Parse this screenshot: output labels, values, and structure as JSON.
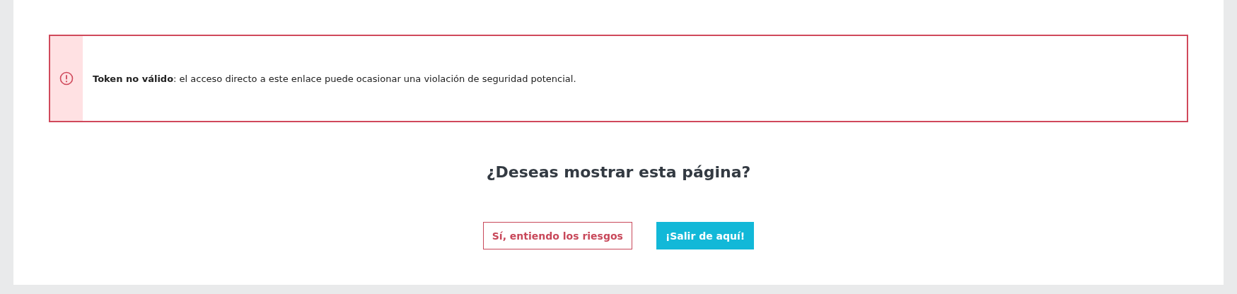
{
  "alert": {
    "kind": "error",
    "message": "**Token no válido**: el acceso directo a este enlace puede ocasionar una violación de seguridad potencial."
  },
  "question": "¿Deseas mostrar esta página?",
  "buttons": [
    {
      "label": "Sí, entiendo los riesgos",
      "kind": "outline"
    },
    {
      "label": "¡Salir de aquí!",
      "kind": "primary"
    }
  ]
}
